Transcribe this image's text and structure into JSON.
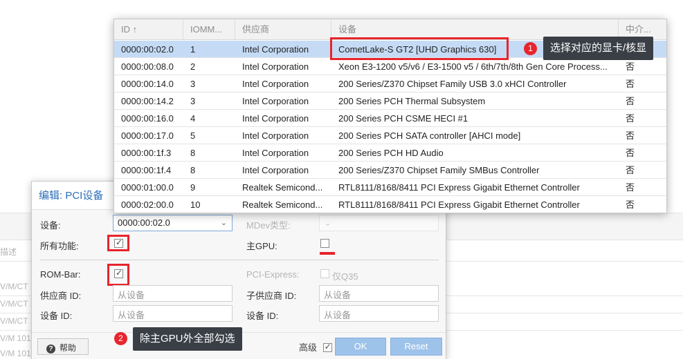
{
  "background": {
    "col_label": "描述",
    "rows": [
      "V/M/CT 1",
      "V/M/CT 1",
      "V/M/CT 1",
      "V/M 101",
      "V/M 101"
    ]
  },
  "dialog": {
    "title": "编辑: PCI设备",
    "device_label": "设备:",
    "device_value": "0000:00:02.0",
    "mdev_label": "MDev类型:",
    "all_functions_label": "所有功能:",
    "primary_gpu_label": "主GPU:",
    "rombar_label": "ROM-Bar:",
    "pcie_label": "PCI-Express:",
    "pcie_option": "仅Q35",
    "vendor_id_label": "供应商 ID:",
    "vendor_id_placeholder": "从设备",
    "sub_vendor_id_label": "子供应商 ID:",
    "sub_vendor_id_placeholder": "从设备",
    "device_id_label": "设备 ID:",
    "device_id_placeholder": "从设备",
    "sub_device_id_label": "设备 ID:",
    "sub_device_id_placeholder": "从设备",
    "help_label": "帮助",
    "advanced_label": "高级",
    "ok_label": "OK",
    "reset_label": "Reset"
  },
  "device_table": {
    "columns": [
      "ID ↑",
      "IOMM...",
      "供应商",
      "设备",
      "中介..."
    ],
    "rows": [
      {
        "id": "0000:00:02.0",
        "iommu": "1",
        "vendor": "Intel Corporation",
        "device": "CometLake-S GT2 [UHD Graphics 630]",
        "mdev": ""
      },
      {
        "id": "0000:00:08.0",
        "iommu": "2",
        "vendor": "Intel Corporation",
        "device": "Xeon E3-1200 v5/v6 / E3-1500 v5 / 6th/7th/8th Gen Core Process...",
        "mdev": "否"
      },
      {
        "id": "0000:00:14.0",
        "iommu": "3",
        "vendor": "Intel Corporation",
        "device": "200 Series/Z370 Chipset Family USB 3.0 xHCI Controller",
        "mdev": "否"
      },
      {
        "id": "0000:00:14.2",
        "iommu": "3",
        "vendor": "Intel Corporation",
        "device": "200 Series PCH Thermal Subsystem",
        "mdev": "否"
      },
      {
        "id": "0000:00:16.0",
        "iommu": "4",
        "vendor": "Intel Corporation",
        "device": "200 Series PCH CSME HECI #1",
        "mdev": "否"
      },
      {
        "id": "0000:00:17.0",
        "iommu": "5",
        "vendor": "Intel Corporation",
        "device": "200 Series PCH SATA controller [AHCI mode]",
        "mdev": "否"
      },
      {
        "id": "0000:00:1f.3",
        "iommu": "8",
        "vendor": "Intel Corporation",
        "device": "200 Series PCH HD Audio",
        "mdev": "否"
      },
      {
        "id": "0000:00:1f.4",
        "iommu": "8",
        "vendor": "Intel Corporation",
        "device": "200 Series/Z370 Chipset Family SMBus Controller",
        "mdev": "否"
      },
      {
        "id": "0000:01:00.0",
        "iommu": "9",
        "vendor": "Realtek Semicond...",
        "device": "RTL8111/8168/8411 PCI Express Gigabit Ethernet Controller",
        "mdev": "否"
      },
      {
        "id": "0000:02:00.0",
        "iommu": "10",
        "vendor": "Realtek Semicond...",
        "device": "RTL8111/8168/8411 PCI Express Gigabit Ethernet Controller",
        "mdev": "否"
      }
    ]
  },
  "annotations": {
    "callout1_num": "1",
    "callout1_text": "选择对应的显卡/核显",
    "callout2_num": "2",
    "callout2_text": "除主GPU外全部勾选"
  },
  "colors": {
    "accent": "#2a6ebb",
    "highlight": "#e8242c",
    "selected_row": "#c5dbf5"
  }
}
